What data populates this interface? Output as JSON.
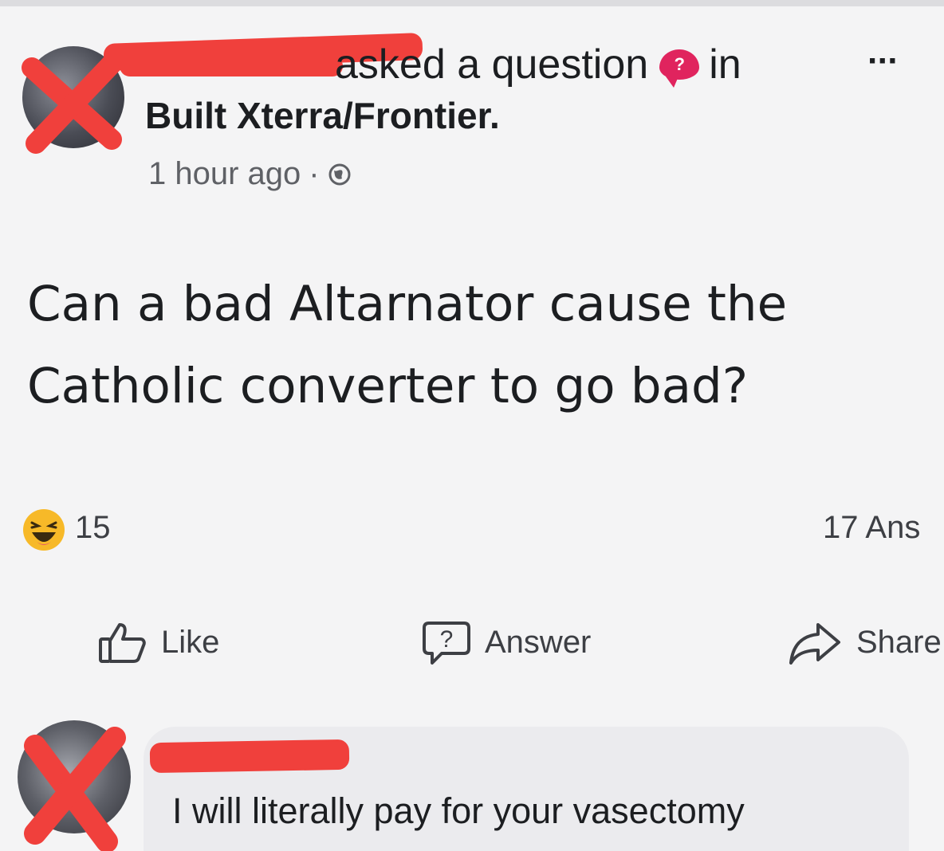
{
  "post": {
    "action_text": "asked a question",
    "in_text": "in",
    "group_name": "Built Xterra/Frontier.",
    "timestamp": "1 hour ago",
    "separator": "·",
    "more_label": "···",
    "question_badge": "?",
    "question_line1": "Can a bad Altarnator cause the",
    "question_line2": "Catholic converter to go bad?",
    "reaction_count": "15",
    "answers_count": "17 Ans"
  },
  "actions": {
    "like": "Like",
    "answer": "Answer",
    "share": "Share"
  },
  "comment": {
    "text": "I will literally pay for your vasectomy"
  },
  "colors": {
    "redaction": "#f0403c",
    "question_badge": "#e0245e",
    "background": "#f4f4f5"
  },
  "icons": {
    "like": "thumbs-up-icon",
    "answer": "question-bubble-icon",
    "share": "share-arrow-icon",
    "privacy": "globe-icon",
    "reaction": "haha-emoji-icon"
  }
}
